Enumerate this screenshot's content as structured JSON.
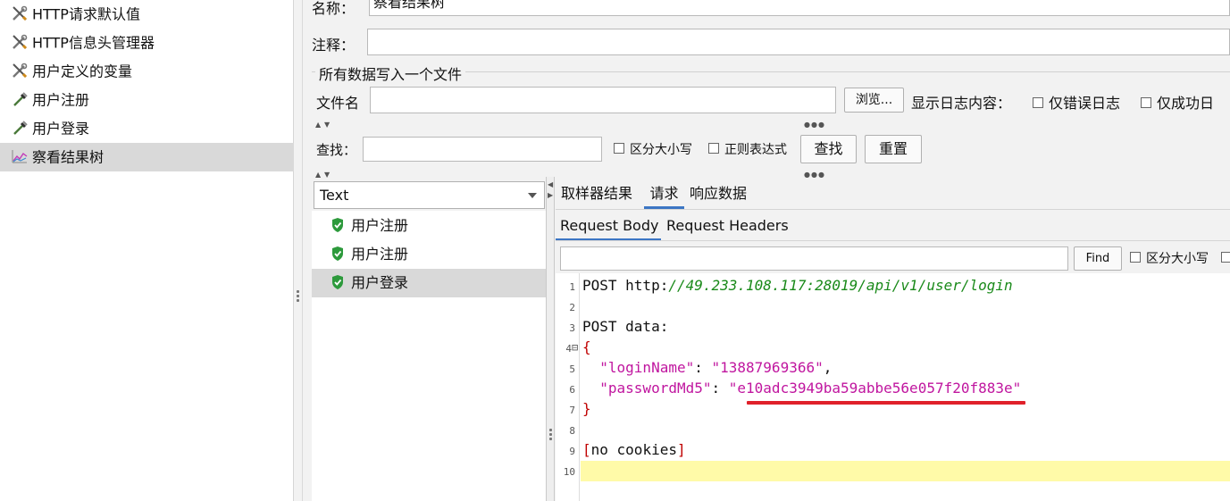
{
  "tree": {
    "items": [
      {
        "label": "HTTP请求默认值",
        "icon": "wrench-screwdriver-icon"
      },
      {
        "label": "HTTP信息头管理器",
        "icon": "wrench-screwdriver-icon"
      },
      {
        "label": "用户定义的变量",
        "icon": "wrench-screwdriver-icon"
      },
      {
        "label": "用户注册",
        "icon": "pipette-icon"
      },
      {
        "label": "用户登录",
        "icon": "pipette-icon"
      },
      {
        "label": "察看结果树",
        "icon": "chart-icon",
        "selected": true
      }
    ]
  },
  "form": {
    "name_label": "名称：",
    "name_value": "察看结果树",
    "comment_label": "注释：",
    "comment_value": "",
    "file_section_title": "所有数据写入一个文件",
    "filename_label": "文件名",
    "filename_value": "",
    "browse_label": "浏览...",
    "log_label": "显示日志内容：",
    "errors_only_label": "仅错误日志",
    "success_only_label": "仅成功日"
  },
  "search": {
    "label": "查找：",
    "value": "",
    "case_sensitive_label": "区分大小写",
    "regex_label": "正则表达式",
    "find_label": "查找",
    "reset_label": "重置"
  },
  "results": {
    "renderer": "Text",
    "items": [
      {
        "label": "用户注册",
        "status": "success"
      },
      {
        "label": "用户注册",
        "status": "success"
      },
      {
        "label": "用户登录",
        "status": "success",
        "selected": true
      }
    ]
  },
  "detail": {
    "tabs": [
      "取样器结果",
      "请求",
      "响应数据"
    ],
    "active_tab": "请求",
    "subtabs": [
      "Request Body",
      "Request Headers"
    ],
    "active_subtab": "Request Body",
    "find_value": "",
    "find_label": "Find",
    "case_label": "区分大小写"
  },
  "code": {
    "line_numbers": [
      "1",
      "2",
      "3",
      "4",
      "5",
      "6",
      "7",
      "8",
      "9",
      "10"
    ],
    "fold_marker": "⊟",
    "line1_method": "POST http:",
    "line1_url": "//49.233.108.117:28019/api/v1/user/login",
    "line3": "POST data:",
    "open_brace": "{",
    "line5_key": "\"loginName\"",
    "line5_sep": ": ",
    "line5_val": "\"13887969366\"",
    "line5_end": ",",
    "line6_key": "\"passwordMd5\"",
    "line6_sep": ": ",
    "line6_val": "\"e10adc3949ba59abbe56e057f20f883e\"",
    "close_brace": "}",
    "cookies_open": "[",
    "cookies_text": "no cookies",
    "cookies_close": "]"
  },
  "colors": {
    "accent_tab": "#3c76c4",
    "url_green": "#1a8a1a",
    "json_magenta": "#c0169f",
    "brace_red": "#c00000",
    "annotation_red": "#e0202a",
    "current_line": "#fffaa8"
  }
}
